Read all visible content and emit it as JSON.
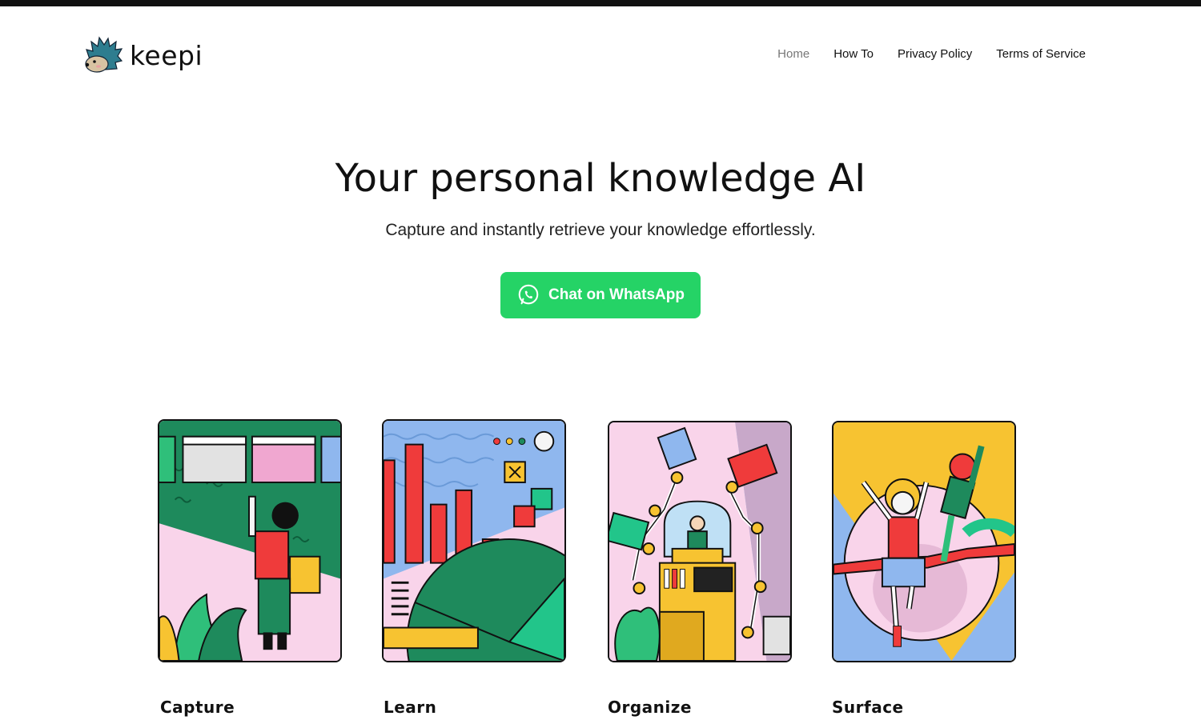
{
  "brand": {
    "name": "keepi",
    "logo_icon": "hedgehog-icon"
  },
  "nav": {
    "items": [
      {
        "label": "Home",
        "active": true
      },
      {
        "label": "How To",
        "active": false
      },
      {
        "label": "Privacy Policy",
        "active": false
      },
      {
        "label": "Terms of Service",
        "active": false
      }
    ]
  },
  "hero": {
    "title": "Your personal knowledge AI",
    "subtitle": "Capture and instantly retrieve your knowledge effortlessly.",
    "cta": {
      "label": "Chat on WhatsApp",
      "icon": "whatsapp-icon",
      "color": "#25d366"
    }
  },
  "features": [
    {
      "title": "Capture"
    },
    {
      "title": "Learn"
    },
    {
      "title": "Organize"
    },
    {
      "title": "Surface"
    }
  ],
  "colors": {
    "accent": "#25d366",
    "text": "#111111",
    "nav_active": "#777777"
  }
}
